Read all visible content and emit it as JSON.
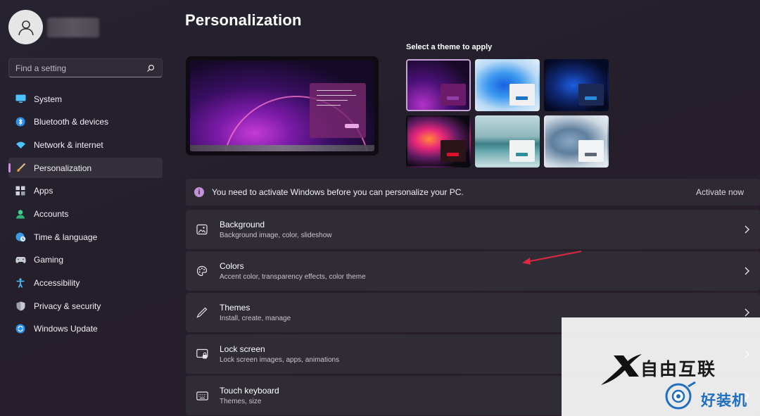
{
  "sidebar": {
    "search": {
      "placeholder": "Find a setting"
    },
    "items": [
      {
        "label": "System",
        "icon": "monitor-icon"
      },
      {
        "label": "Bluetooth & devices",
        "icon": "bluetooth-icon"
      },
      {
        "label": "Network & internet",
        "icon": "wifi-icon"
      },
      {
        "label": "Personalization",
        "icon": "brush-icon",
        "active": true
      },
      {
        "label": "Apps",
        "icon": "apps-icon"
      },
      {
        "label": "Accounts",
        "icon": "person-icon"
      },
      {
        "label": "Time & language",
        "icon": "globe-clock-icon"
      },
      {
        "label": "Gaming",
        "icon": "gamepad-icon"
      },
      {
        "label": "Accessibility",
        "icon": "accessibility-icon"
      },
      {
        "label": "Privacy & security",
        "icon": "shield-icon"
      },
      {
        "label": "Windows Update",
        "icon": "update-icon"
      }
    ]
  },
  "main": {
    "title": "Personalization",
    "theme_heading": "Select a theme to apply",
    "themes": [
      {
        "name": "windows-glow-theme",
        "selected": true
      },
      {
        "name": "windows-light-theme"
      },
      {
        "name": "windows-dark-theme"
      },
      {
        "name": "captured-motion-theme"
      },
      {
        "name": "sunrise-lake-theme"
      },
      {
        "name": "flow-theme"
      }
    ],
    "notice": {
      "message": "You need to activate Windows before you can personalize your PC.",
      "action": "Activate now"
    },
    "cards": [
      {
        "title": "Background",
        "subtitle": "Background image, color, slideshow",
        "icon": "image-icon"
      },
      {
        "title": "Colors",
        "subtitle": "Accent color, transparency effects, color theme",
        "icon": "palette-icon"
      },
      {
        "title": "Themes",
        "subtitle": "Install, create, manage",
        "icon": "pen-icon"
      },
      {
        "title": "Lock screen",
        "subtitle": "Lock screen images, apps, animations",
        "icon": "lock-screen-icon"
      },
      {
        "title": "Touch keyboard",
        "subtitle": "Themes, size",
        "icon": "keyboard-icon"
      }
    ]
  },
  "watermark": {
    "line1": "自由互联",
    "line2": "好装机"
  },
  "colors": {
    "accent": "#c892d6",
    "background": "#241f2b",
    "card": "#302c36",
    "annotation_arrow": "#d9283f"
  }
}
